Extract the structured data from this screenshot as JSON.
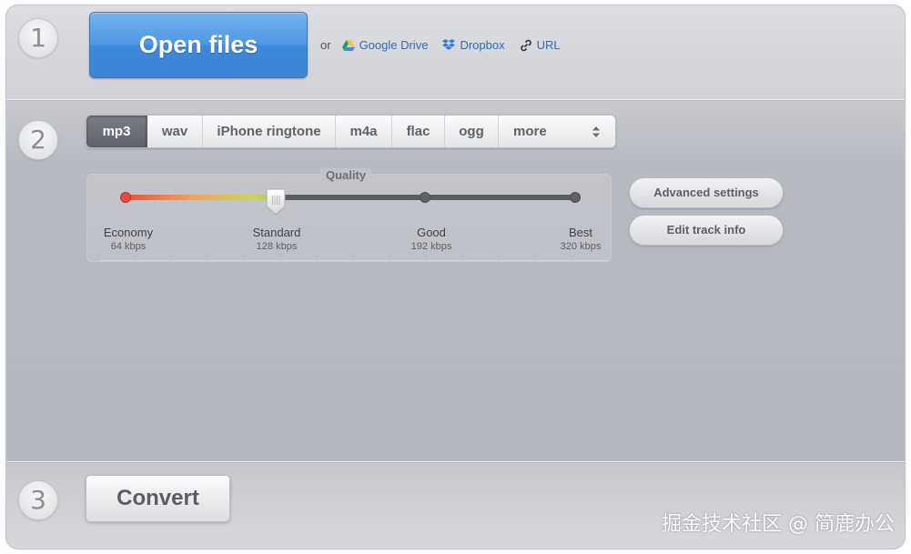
{
  "steps": {
    "one": "1",
    "two": "2",
    "three": "3"
  },
  "open": {
    "button_label": "Open files",
    "or_text": "or",
    "sources": [
      {
        "label": "Google Drive",
        "icon": "google-drive-icon"
      },
      {
        "label": "Dropbox",
        "icon": "dropbox-icon"
      },
      {
        "label": "URL",
        "icon": "link-icon"
      }
    ]
  },
  "formats": {
    "items": [
      "mp3",
      "wav",
      "iPhone ringtone",
      "m4a",
      "flac",
      "ogg"
    ],
    "selected": "mp3",
    "more_label": "more"
  },
  "quality": {
    "title": "Quality",
    "selected_index": 1,
    "levels": [
      {
        "name": "Economy",
        "rate": "64 kbps"
      },
      {
        "name": "Standard",
        "rate": "128 kbps"
      },
      {
        "name": "Good",
        "rate": "192 kbps"
      },
      {
        "name": "Best",
        "rate": "320 kbps"
      }
    ]
  },
  "settings": {
    "advanced_label": "Advanced settings",
    "edit_track_label": "Edit track info"
  },
  "convert": {
    "button_label": "Convert"
  },
  "watermark": "掘金技术社区 @ 简鹿办公",
  "colors": {
    "primary_blue": "#4f98e4",
    "link_blue": "#2a6fc4",
    "active_tab": "#5d6269",
    "slider_low": "#e84b3c"
  }
}
